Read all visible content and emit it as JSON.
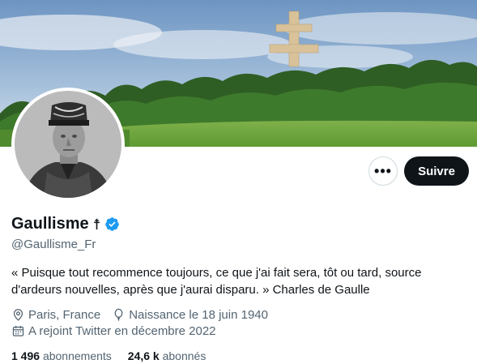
{
  "profile": {
    "display_name": "Gaullisme",
    "name_glyph": "☨",
    "handle": "@Gaullisme_Fr",
    "bio": "« Puisque tout recommence toujours, ce que j'ai fait sera, tôt ou tard, source d'ardeurs nouvelles, après que j'aurai disparu. » Charles de Gaulle",
    "location": "Paris, France",
    "birth": "Naissance le 18 juin 1940",
    "joined": "A rejoint Twitter en décembre 2022",
    "following_count": "1 496",
    "following_label": "abonnements",
    "followers_count": "24,6 k",
    "followers_label": "abonnés"
  },
  "actions": {
    "more_label": "•••",
    "follow_label": "Suivre"
  },
  "colors": {
    "accent": "#1d9bf0",
    "button_dark": "#0f1419",
    "secondary_text": "#536471"
  },
  "icons": {
    "location": "location-pin-icon",
    "birth": "balloon-icon",
    "joined": "calendar-icon",
    "verified": "verified-badge-icon"
  }
}
